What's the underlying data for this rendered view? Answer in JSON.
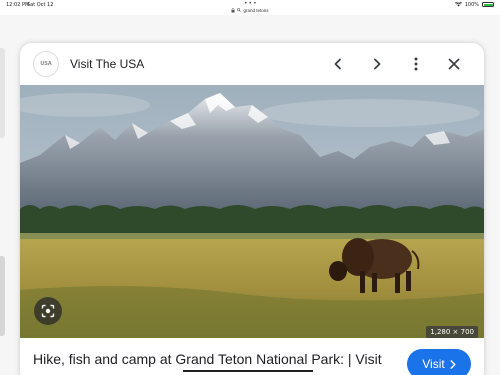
{
  "status_bar": {
    "time": "12:02 PM",
    "date": "Sat Oct 12",
    "dots": "•••",
    "battery": "100%",
    "battery_level": 1.0,
    "battery_color": "#2ec04a"
  },
  "address_bar": {
    "url": "grand tetons"
  },
  "sheet": {
    "site_logo": "USA",
    "site_name": "Visit The USA",
    "image_dimensions": "1,280 × 700",
    "caption": "Hike, fish and camp at Grand Teton National Park: | Visit",
    "visit_label": "Visit"
  },
  "colors": {
    "accent": "#1a73e8"
  }
}
